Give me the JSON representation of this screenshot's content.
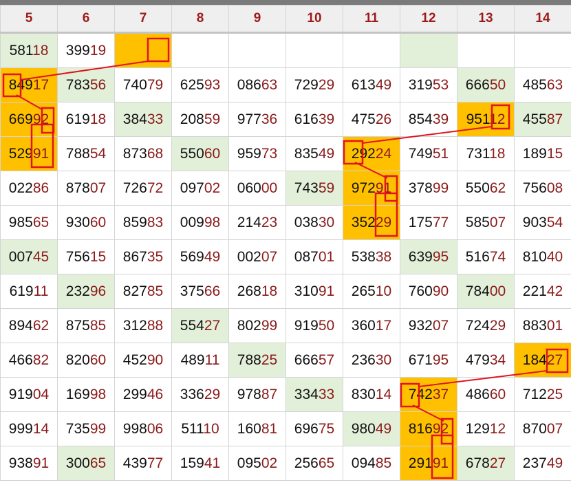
{
  "columns": [
    "5",
    "6",
    "7",
    "8",
    "9",
    "10",
    "11",
    "12",
    "13",
    "14"
  ],
  "rows": [
    [
      {
        "v": "58118",
        "bg": "g"
      },
      {
        "v": "39919",
        "bg": ""
      },
      {
        "v": "",
        "bg": "y"
      },
      {
        "v": "",
        "bg": ""
      },
      {
        "v": "",
        "bg": ""
      },
      {
        "v": "",
        "bg": ""
      },
      {
        "v": "",
        "bg": ""
      },
      {
        "v": "",
        "bg": "g"
      },
      {
        "v": "",
        "bg": ""
      },
      {
        "v": "",
        "bg": ""
      }
    ],
    [
      {
        "v": "84917",
        "bg": "y"
      },
      {
        "v": "78356",
        "bg": "g"
      },
      {
        "v": "74079",
        "bg": ""
      },
      {
        "v": "62593",
        "bg": ""
      },
      {
        "v": "08663",
        "bg": ""
      },
      {
        "v": "72929",
        "bg": ""
      },
      {
        "v": "61349",
        "bg": ""
      },
      {
        "v": "31953",
        "bg": ""
      },
      {
        "v": "66650",
        "bg": "g"
      },
      {
        "v": "48563",
        "bg": ""
      }
    ],
    [
      {
        "v": "66992",
        "bg": "y"
      },
      {
        "v": "61918",
        "bg": ""
      },
      {
        "v": "38433",
        "bg": "g"
      },
      {
        "v": "20859",
        "bg": ""
      },
      {
        "v": "97736",
        "bg": ""
      },
      {
        "v": "61639",
        "bg": ""
      },
      {
        "v": "47526",
        "bg": ""
      },
      {
        "v": "85439",
        "bg": ""
      },
      {
        "v": "95112",
        "bg": "y"
      },
      {
        "v": "45587",
        "bg": "g"
      }
    ],
    [
      {
        "v": "52991",
        "bg": "y"
      },
      {
        "v": "78854",
        "bg": ""
      },
      {
        "v": "87368",
        "bg": ""
      },
      {
        "v": "55060",
        "bg": "g"
      },
      {
        "v": "95973",
        "bg": ""
      },
      {
        "v": "83549",
        "bg": ""
      },
      {
        "v": "29224",
        "bg": "y"
      },
      {
        "v": "74951",
        "bg": ""
      },
      {
        "v": "73118",
        "bg": ""
      },
      {
        "v": "18915",
        "bg": ""
      }
    ],
    [
      {
        "v": "02286",
        "bg": ""
      },
      {
        "v": "87807",
        "bg": ""
      },
      {
        "v": "72672",
        "bg": ""
      },
      {
        "v": "09702",
        "bg": ""
      },
      {
        "v": "06000",
        "bg": ""
      },
      {
        "v": "74359",
        "bg": "g"
      },
      {
        "v": "97291",
        "bg": "y"
      },
      {
        "v": "37899",
        "bg": ""
      },
      {
        "v": "55062",
        "bg": ""
      },
      {
        "v": "75608",
        "bg": ""
      }
    ],
    [
      {
        "v": "98565",
        "bg": ""
      },
      {
        "v": "93060",
        "bg": ""
      },
      {
        "v": "85983",
        "bg": ""
      },
      {
        "v": "00998",
        "bg": ""
      },
      {
        "v": "21423",
        "bg": ""
      },
      {
        "v": "03830",
        "bg": ""
      },
      {
        "v": "35229",
        "bg": "y"
      },
      {
        "v": "17577",
        "bg": ""
      },
      {
        "v": "58507",
        "bg": ""
      },
      {
        "v": "90354",
        "bg": ""
      }
    ],
    [
      {
        "v": "00745",
        "bg": "g"
      },
      {
        "v": "75615",
        "bg": ""
      },
      {
        "v": "86735",
        "bg": ""
      },
      {
        "v": "56949",
        "bg": ""
      },
      {
        "v": "00207",
        "bg": ""
      },
      {
        "v": "08701",
        "bg": ""
      },
      {
        "v": "53838",
        "bg": ""
      },
      {
        "v": "63995",
        "bg": "g"
      },
      {
        "v": "51674",
        "bg": ""
      },
      {
        "v": "81040",
        "bg": ""
      }
    ],
    [
      {
        "v": "61911",
        "bg": ""
      },
      {
        "v": "23296",
        "bg": "g"
      },
      {
        "v": "82785",
        "bg": ""
      },
      {
        "v": "37566",
        "bg": ""
      },
      {
        "v": "26818",
        "bg": ""
      },
      {
        "v": "31091",
        "bg": ""
      },
      {
        "v": "26510",
        "bg": ""
      },
      {
        "v": "76090",
        "bg": ""
      },
      {
        "v": "78400",
        "bg": "g"
      },
      {
        "v": "22142",
        "bg": ""
      }
    ],
    [
      {
        "v": "89462",
        "bg": ""
      },
      {
        "v": "87585",
        "bg": ""
      },
      {
        "v": "31288",
        "bg": ""
      },
      {
        "v": "55427",
        "bg": "g"
      },
      {
        "v": "80299",
        "bg": ""
      },
      {
        "v": "91950",
        "bg": ""
      },
      {
        "v": "36017",
        "bg": ""
      },
      {
        "v": "93207",
        "bg": ""
      },
      {
        "v": "72429",
        "bg": ""
      },
      {
        "v": "88301",
        "bg": ""
      }
    ],
    [
      {
        "v": "46682",
        "bg": ""
      },
      {
        "v": "82060",
        "bg": ""
      },
      {
        "v": "45290",
        "bg": ""
      },
      {
        "v": "48911",
        "bg": ""
      },
      {
        "v": "78825",
        "bg": "g"
      },
      {
        "v": "66657",
        "bg": ""
      },
      {
        "v": "23630",
        "bg": ""
      },
      {
        "v": "67195",
        "bg": ""
      },
      {
        "v": "47934",
        "bg": ""
      },
      {
        "v": "18427",
        "bg": "y"
      }
    ],
    [
      {
        "v": "91904",
        "bg": ""
      },
      {
        "v": "16998",
        "bg": ""
      },
      {
        "v": "29946",
        "bg": ""
      },
      {
        "v": "33629",
        "bg": ""
      },
      {
        "v": "97887",
        "bg": ""
      },
      {
        "v": "33433",
        "bg": "g"
      },
      {
        "v": "83014",
        "bg": ""
      },
      {
        "v": "74237",
        "bg": "y"
      },
      {
        "v": "48660",
        "bg": ""
      },
      {
        "v": "71225",
        "bg": ""
      }
    ],
    [
      {
        "v": "99914",
        "bg": ""
      },
      {
        "v": "73599",
        "bg": ""
      },
      {
        "v": "99806",
        "bg": ""
      },
      {
        "v": "51110",
        "bg": ""
      },
      {
        "v": "16081",
        "bg": ""
      },
      {
        "v": "69675",
        "bg": ""
      },
      {
        "v": "98049",
        "bg": "g"
      },
      {
        "v": "81692",
        "bg": "y"
      },
      {
        "v": "12912",
        "bg": ""
      },
      {
        "v": "87007",
        "bg": ""
      }
    ],
    [
      {
        "v": "93891",
        "bg": ""
      },
      {
        "v": "30065",
        "bg": "g"
      },
      {
        "v": "43977",
        "bg": ""
      },
      {
        "v": "15941",
        "bg": ""
      },
      {
        "v": "09502",
        "bg": ""
      },
      {
        "v": "25665",
        "bg": ""
      },
      {
        "v": "09485",
        "bg": ""
      },
      {
        "v": "29191",
        "bg": "y"
      },
      {
        "v": "67827",
        "bg": "g"
      },
      {
        "v": "23749",
        "bg": ""
      }
    ]
  ],
  "colors": {
    "highlight": "#ffc000",
    "tint": "#e2f0d9",
    "marker": "#e0141e",
    "digit_tail": "#8b1a1a"
  }
}
